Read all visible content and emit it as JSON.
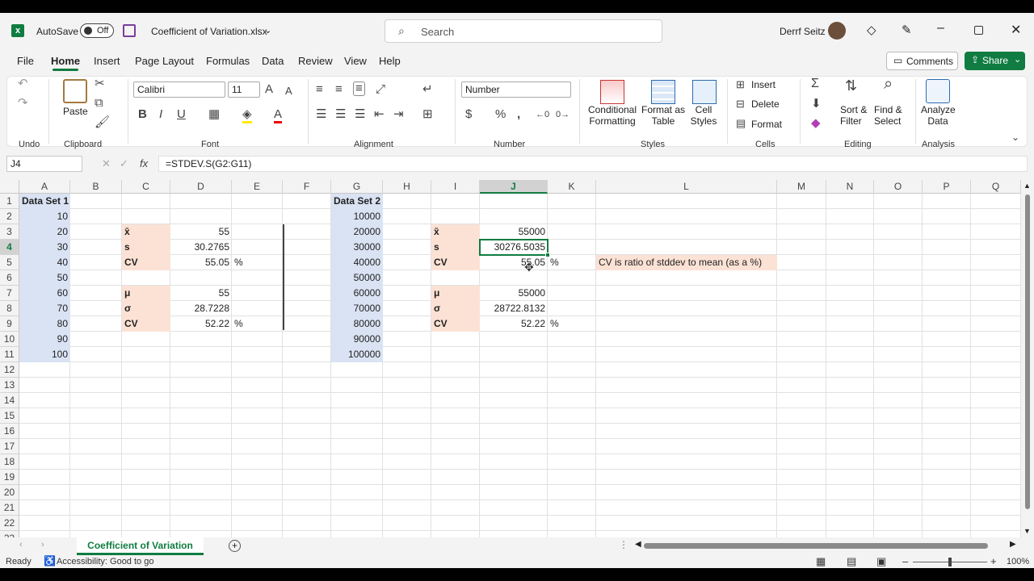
{
  "titlebar": {
    "autosave_label": "AutoSave",
    "autosave_state": "Off",
    "filename": "Coefficient of Variation.xlsx",
    "search_placeholder": "Search",
    "user_name": "Derrf Seitz"
  },
  "tabs": [
    "File",
    "Home",
    "Insert",
    "Page Layout",
    "Formulas",
    "Data",
    "Review",
    "View",
    "Help"
  ],
  "active_tab": "Home",
  "actions": {
    "comments": "Comments",
    "share": "Share"
  },
  "ribbon": {
    "groups": {
      "undo": "Undo",
      "clipboard": "Clipboard",
      "font": "Font",
      "alignment": "Alignment",
      "number": "Number",
      "styles": "Styles",
      "cells": "Cells",
      "editing": "Editing",
      "analysis": "Analysis"
    },
    "paste": "Paste",
    "font_name": "Calibri",
    "font_size": "11",
    "number_format": "Number",
    "conditional_formatting": [
      "Conditional",
      "Formatting"
    ],
    "format_as_table": [
      "Format as",
      "Table"
    ],
    "cell_styles": [
      "Cell",
      "Styles"
    ],
    "insert": "Insert",
    "delete": "Delete",
    "format": "Format",
    "sort_filter": [
      "Sort &",
      "Filter"
    ],
    "find_select": [
      "Find &",
      "Select"
    ],
    "analyze_data": [
      "Analyze",
      "Data"
    ]
  },
  "formula_bar": {
    "name_box": "J4",
    "fx": "fx",
    "formula": "=STDEV.S(G2:G11)"
  },
  "columns": [
    "A",
    "B",
    "C",
    "D",
    "E",
    "F",
    "G",
    "H",
    "I",
    "J",
    "K",
    "L",
    "M",
    "N",
    "O",
    "P",
    "Q"
  ],
  "rows": [
    "1",
    "2",
    "3",
    "4",
    "5",
    "6",
    "7",
    "8",
    "9",
    "10",
    "11",
    "12",
    "13",
    "14",
    "15",
    "16",
    "17",
    "18",
    "19",
    "20",
    "21",
    "22",
    "23"
  ],
  "selected_cell": {
    "col": "J",
    "row": "4"
  },
  "sheet": {
    "A1": "Data Set 1",
    "A": [
      "10",
      "20",
      "30",
      "40",
      "50",
      "60",
      "70",
      "80",
      "90",
      "100"
    ],
    "G1": "Data Set 2",
    "G": [
      "10000",
      "20000",
      "30000",
      "40000",
      "50000",
      "60000",
      "70000",
      "80000",
      "90000",
      "100000"
    ],
    "C3": "x̄",
    "D3": "55",
    "C4": "s",
    "D4": "30.2765",
    "C5": "CV",
    "D5": "55.05",
    "E5": "%",
    "C7": "μ",
    "D7": "55",
    "C8": "σ",
    "D8": "28.7228",
    "C9": "CV",
    "D9": "52.22",
    "E9": "%",
    "I3": "x̄",
    "J3": "55000",
    "I4": "s",
    "J4": "30276.5035",
    "I5": "CV",
    "J5": "55.05",
    "K5": "%",
    "I7": "μ",
    "J7": "55000",
    "I8": "σ",
    "J8": "28722.8132",
    "I9": "CV",
    "J9": "52.22",
    "K9": "%",
    "L5": "CV is ratio of stddev to mean (as a %)"
  },
  "sheet_tab": "Coefficient of Variation",
  "status": {
    "ready": "Ready",
    "accessibility": "Accessibility: Good to go",
    "zoom": "100%"
  },
  "colors": {
    "accent": "#107c41",
    "fill_blue": "#dae3f3",
    "fill_peach": "#fbe2d5"
  }
}
